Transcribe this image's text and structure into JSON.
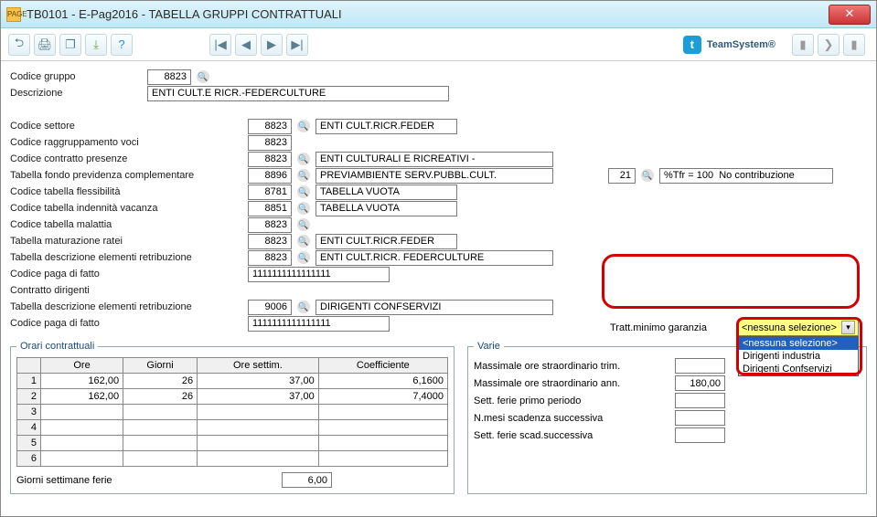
{
  "window": {
    "title": "TB0101  -  E-Pag2016  -  TABELLA GRUPPI CONTRATTUALI",
    "icon_text": "PAGE"
  },
  "brand": {
    "name": "TeamSystem",
    "mark": "®"
  },
  "head": {
    "codice_gruppo_lbl": "Codice gruppo",
    "codice_gruppo_val": "8823",
    "descrizione_lbl": "Descrizione",
    "descrizione_val": "ENTI CULT.E RICR.-FEDERCULTURE"
  },
  "rows": [
    {
      "lbl": "Codice settore",
      "code": "8823",
      "lookup": true,
      "desc": "ENTI CULT.RICR.FEDER",
      "dw": "w155"
    },
    {
      "lbl": "Codice raggruppamento voci",
      "code": "8823",
      "lookup": false,
      "desc": null
    },
    {
      "lbl": "Codice contratto presenze",
      "code": "8823",
      "lookup": true,
      "desc": "ENTI CULTURALI E RICREATIVI -",
      "dw": "w260"
    },
    {
      "lbl": "Tabella fondo previdenza complementare",
      "code": "8896",
      "lookup": true,
      "desc": "PREVIAMBIENTE SERV.PUBBL.CULT.",
      "dw": "w260",
      "extra_code": "21",
      "extra_desc": "%Tfr = 100  No contribuzione"
    },
    {
      "lbl": "Codice tabella flessibilità",
      "code": "8781",
      "lookup": true,
      "desc": "TABELLA VUOTA",
      "dw": "w155"
    },
    {
      "lbl": "Codice tabella indennità vacanza",
      "code": "8851",
      "lookup": true,
      "desc": "TABELLA VUOTA",
      "dw": "w155"
    },
    {
      "lbl": "Codice tabella malattia",
      "code": "8823",
      "lookup": true,
      "desc": null
    },
    {
      "lbl": "Tabella maturazione ratei",
      "code": "8823",
      "lookup": true,
      "desc": "ENTI CULT.RICR.FEDER",
      "dw": "w155"
    },
    {
      "lbl": "Tabella descrizione elementi retribuzione",
      "code": "8823",
      "lookup": true,
      "desc": "ENTI CULT.RICR. FEDERCULTURE",
      "dw": "w260"
    }
  ],
  "codice_paga_lbl": "Codice paga di fatto",
  "codice_paga_val": "1111111111111111",
  "contratto_dirigenti_lbl": "Contratto dirigenti",
  "rows2": [
    {
      "lbl": "Tabella descrizione elementi retribuzione",
      "code": "9006",
      "lookup": true,
      "desc": "DIRIGENTI CONFSERVIZI",
      "dw": "w260"
    }
  ],
  "codice_paga2_lbl": "Codice paga di fatto",
  "codice_paga2_val": "1111111111111111",
  "tratt": {
    "lbl": "Tratt.minimo garanzia",
    "selected": "<nessuna selezione>",
    "options": [
      "<nessuna selezione>",
      "Dirigenti industria",
      "Dirigenti Confservizi"
    ]
  },
  "orari": {
    "legend": "Orari contrattuali",
    "headers": [
      "",
      "Ore",
      "Giorni",
      "Ore settim.",
      "Coefficiente"
    ],
    "rows": [
      [
        "1",
        "162,00",
        "26",
        "37,00",
        "6,1600"
      ],
      [
        "2",
        "162,00",
        "26",
        "37,00",
        "7,4000"
      ],
      [
        "3",
        "",
        "",
        "",
        ""
      ],
      [
        "4",
        "",
        "",
        "",
        ""
      ],
      [
        "5",
        "",
        "",
        "",
        ""
      ],
      [
        "6",
        "",
        "",
        "",
        ""
      ]
    ],
    "gsf_lbl": "Giorni settimane ferie",
    "gsf_val": "6,00"
  },
  "varie": {
    "legend": "Varie",
    "items": [
      {
        "lbl": "Massimale ore straordinario trim.",
        "val": ""
      },
      {
        "lbl": "Massimale ore straordinario ann.",
        "val": "180,00"
      },
      {
        "lbl": "Sett. ferie  primo periodo",
        "val": ""
      },
      {
        "lbl": "N.mesi scadenza successiva",
        "val": ""
      },
      {
        "lbl": "Sett. ferie scad.successiva",
        "val": ""
      }
    ]
  }
}
